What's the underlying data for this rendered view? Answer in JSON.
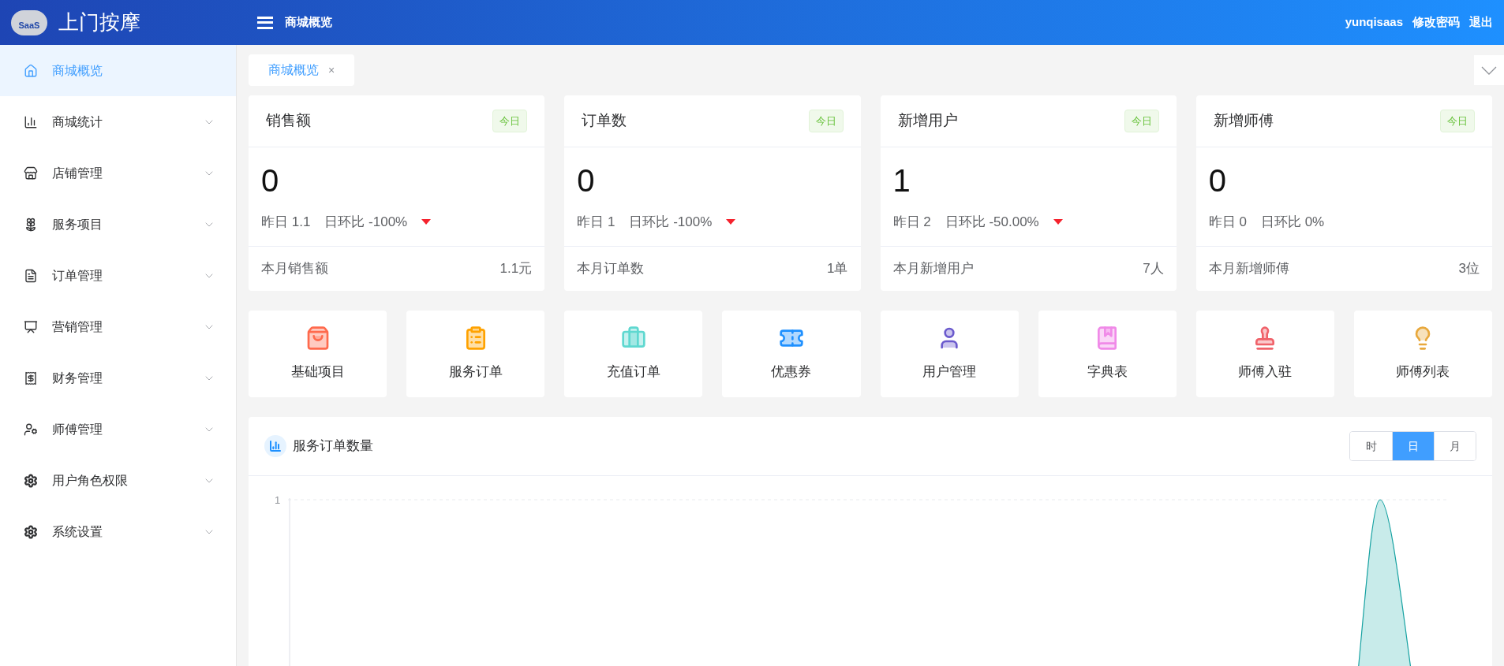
{
  "header": {
    "logo_badge": "SaaS",
    "app_title": "上门按摩",
    "page_title": "商城概览",
    "user": "yunqisaas",
    "links": [
      "修改密码",
      "退出"
    ]
  },
  "sidebar": {
    "items": [
      {
        "label": "商城概览",
        "selected": true,
        "expandable": false
      },
      {
        "label": "商城统计",
        "selected": false,
        "expandable": true
      },
      {
        "label": "店铺管理",
        "selected": false,
        "expandable": true
      },
      {
        "label": "服务项目",
        "selected": false,
        "expandable": true
      },
      {
        "label": "订单管理",
        "selected": false,
        "expandable": true
      },
      {
        "label": "营销管理",
        "selected": false,
        "expandable": true
      },
      {
        "label": "财务管理",
        "selected": false,
        "expandable": true
      },
      {
        "label": "师傅管理",
        "selected": false,
        "expandable": true
      },
      {
        "label": "用户角色权限",
        "selected": false,
        "expandable": true
      },
      {
        "label": "系统设置",
        "selected": false,
        "expandable": true
      }
    ]
  },
  "tabs": [
    {
      "label": "商城概览",
      "selected": true,
      "close": "×"
    }
  ],
  "stat_cards": [
    {
      "title": "销售额",
      "badge": "今日",
      "value": "0",
      "yesterday": "昨日 1.1",
      "ratio": "日环比 -100%",
      "declining": true,
      "footer_label": "本月销售额",
      "footer_value": "1.1元"
    },
    {
      "title": "订单数",
      "badge": "今日",
      "value": "0",
      "yesterday": "昨日 1",
      "ratio": "日环比 -100%",
      "declining": true,
      "footer_label": "本月订单数",
      "footer_value": "1单"
    },
    {
      "title": "新增用户",
      "badge": "今日",
      "value": "1",
      "yesterday": "昨日 2",
      "ratio": "日环比 -50.00%",
      "declining": true,
      "footer_label": "本月新增用户",
      "footer_value": "7人"
    },
    {
      "title": "新增师傅",
      "badge": "今日",
      "value": "0",
      "yesterday": "昨日 0",
      "ratio": "日环比 0%",
      "declining": false,
      "footer_label": "本月新增师傅",
      "footer_value": "3位"
    }
  ],
  "shortcuts": [
    "基础项目",
    "服务订单",
    "充值订单",
    "优惠券",
    "用户管理",
    "字典表",
    "师傅入驻",
    "师傅列表"
  ],
  "chart_panel": {
    "title": "服务订单数量",
    "periods": [
      {
        "label": "时",
        "selected": false
      },
      {
        "label": "日",
        "selected": true
      },
      {
        "label": "月",
        "selected": false
      }
    ],
    "y_tick": "1"
  }
}
